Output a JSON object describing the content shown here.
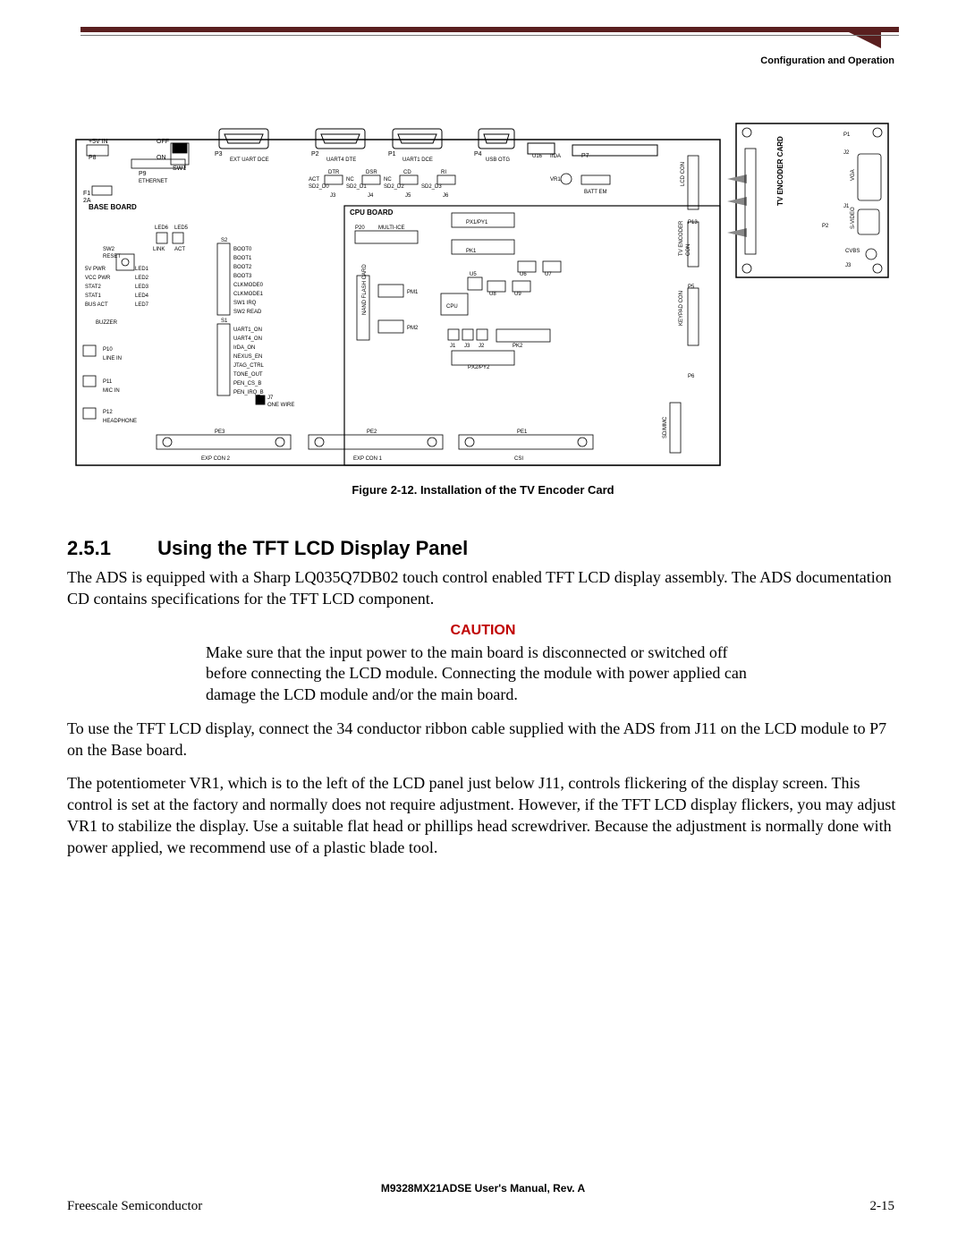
{
  "header": {
    "section": "Configuration and Operation"
  },
  "figure": {
    "caption": "Figure 2-12.  Installation of the TV Encoder Card",
    "base_board": "BASE BOARD",
    "cpu_board": "CPU BOARD",
    "tv_encoder": "TV ENCODER CARD",
    "nand_flash": "NAND FLASH CARD",
    "labels": {
      "p5v": "+5V IN",
      "p8": "P8",
      "off": "OFF",
      "on": "ON",
      "sw1": "SW1",
      "f1": "F1",
      "f1b": "2A",
      "p9": "P9",
      "eth": "ETHERNET",
      "p3": "P3",
      "ext": "EXT UART DCE",
      "p2": "P2",
      "u4dte": "UART4 DTE",
      "p1": "P1",
      "u1dce": "UART1 DCE",
      "p4": "P4",
      "usbotg": "USB OTG",
      "u16": "U16",
      "irda": "IrDA",
      "p7": "P7",
      "dtr": "DTR",
      "dsr": "DSR",
      "cd": "CD",
      "ri": "RI",
      "act": "ACT",
      "nc": "NC",
      "sd0": "SD2_D0",
      "sd1": "SD2_D1",
      "sd2": "SD2_D2",
      "sd3": "SD2_D3",
      "j3": "J3",
      "j4": "J4",
      "j5": "J5",
      "j6": "J6",
      "vr1": "VR1",
      "batt": "BATT EM",
      "lcdcon": "LCD CON",
      "led6": "LED6",
      "led5": "LED5",
      "sw2": "SW2",
      "reset": "RESET",
      "link": "LINK",
      "acts": "ACT",
      "s2": "S2",
      "r1": "5V PWR",
      "l1": "LED1",
      "r2": "VCC PWR",
      "l2": "LED2",
      "r3": "STAT2",
      "l3": "LED3",
      "r4": "STAT1",
      "l4": "LED4",
      "r5": "BUS ACT",
      "l7": "LED7",
      "buzzer": "BUZZER",
      "s1": "S1",
      "b0": "BOOT0",
      "b1": "BOOT1",
      "b2": "BOOT2",
      "b3": "BOOT3",
      "cm0": "CLKMODE0",
      "cm1": "CLKMODE1",
      "swirq": "SW1 IRQ",
      "swread": "SW2 READ",
      "u1on": "UART1_ON",
      "u4on": "UART4_ON",
      "irdaon": "IrDA_ON",
      "nexus": "NEXUS_EN",
      "jtag": "JTAG_CTRL",
      "tone": "TONE_OUT",
      "pencs": "PEN_CS_B",
      "penirq": "PEN_IRQ_B",
      "p10": "P10",
      "linein": "LINE IN",
      "p11": "P11",
      "micin": "MIC IN",
      "p12": "P12",
      "hp": "HEADPHONE",
      "j7": "J7",
      "onewire": "ONE WIRE",
      "p20": "P20",
      "multi": "MULTI-ICE",
      "px1": "PX1/PY1",
      "pk1": "PK1",
      "u5": "U5",
      "u6": "U6",
      "u7": "U7",
      "u8": "U8",
      "u9": "U9",
      "pm1": "PM1",
      "pm2": "PM2",
      "cpu": "CPU",
      "j1c": "J1",
      "j2c": "J2",
      "j3c": "J3",
      "pk2": "PK2",
      "px2": "PX2/PY2",
      "p13": "P13",
      "tvenc": "TV ENCODER",
      "con": "CON",
      "p5": "P5",
      "keypad": "KEYPAD CON",
      "p6": "P6",
      "sdmmc": "SD/MMC",
      "pe3": "PE3",
      "pe2": "PE2",
      "pe1": "PE1",
      "exp2": "EXP CON 2",
      "exp1": "EXP CON 1",
      "csi": "CSI",
      "p1t": "P1",
      "j2t": "J2",
      "vga": "VGA",
      "j1t": "J1",
      "p2t": "P2",
      "svideo": "S-VIDEO",
      "cvbs": "CVBS",
      "j3t": "J3"
    }
  },
  "section": {
    "num": "2.5.1",
    "title": "Using the TFT LCD Display Panel"
  },
  "para1": "The ADS is equipped with a Sharp LQ035Q7DB02 touch control enabled TFT LCD display assembly. The ADS documentation CD contains specifications for the TFT LCD component.",
  "caution": {
    "head": "CAUTION",
    "body": "Make sure that the input power to the main board is disconnected or switched off before connecting the LCD module. Connecting the module with power applied can damage the LCD module and/or the main board."
  },
  "para2": "To use the TFT LCD display, connect the 34 conductor ribbon cable supplied with the ADS from J11 on the LCD module to P7 on the Base board.",
  "para3": "The potentiometer VR1, which is to the left of the LCD panel just below J11, controls flickering of the display screen. This control is set at the factory and normally does not require adjustment. However, if the TFT LCD display flickers, you may adjust VR1 to stabilize the display. Use a suitable flat head or phillips head screwdriver. Because the adjustment is normally done with power applied, we recommend use of a plastic blade tool.",
  "footer": {
    "center": "M9328MX21ADSE User's Manual, Rev. A",
    "left": "Freescale Semiconductor",
    "right": "2-15"
  }
}
